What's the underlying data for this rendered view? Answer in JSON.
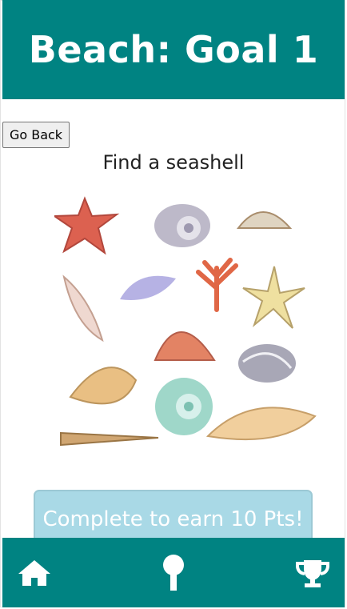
{
  "header": {
    "title": "Beach: Goal 1"
  },
  "back_button": {
    "label": "Go Back"
  },
  "goal": {
    "prompt": "Find a seashell",
    "image_alt": "seashells and starfish watercolor illustration"
  },
  "complete_button": {
    "label": "Complete to earn 10 Pts!"
  },
  "nav": {
    "items": [
      {
        "icon": "home-icon"
      },
      {
        "icon": "pin-icon"
      },
      {
        "icon": "trophy-icon"
      }
    ]
  },
  "colors": {
    "primary": "#008382",
    "button_light": "#a9d9e6"
  }
}
